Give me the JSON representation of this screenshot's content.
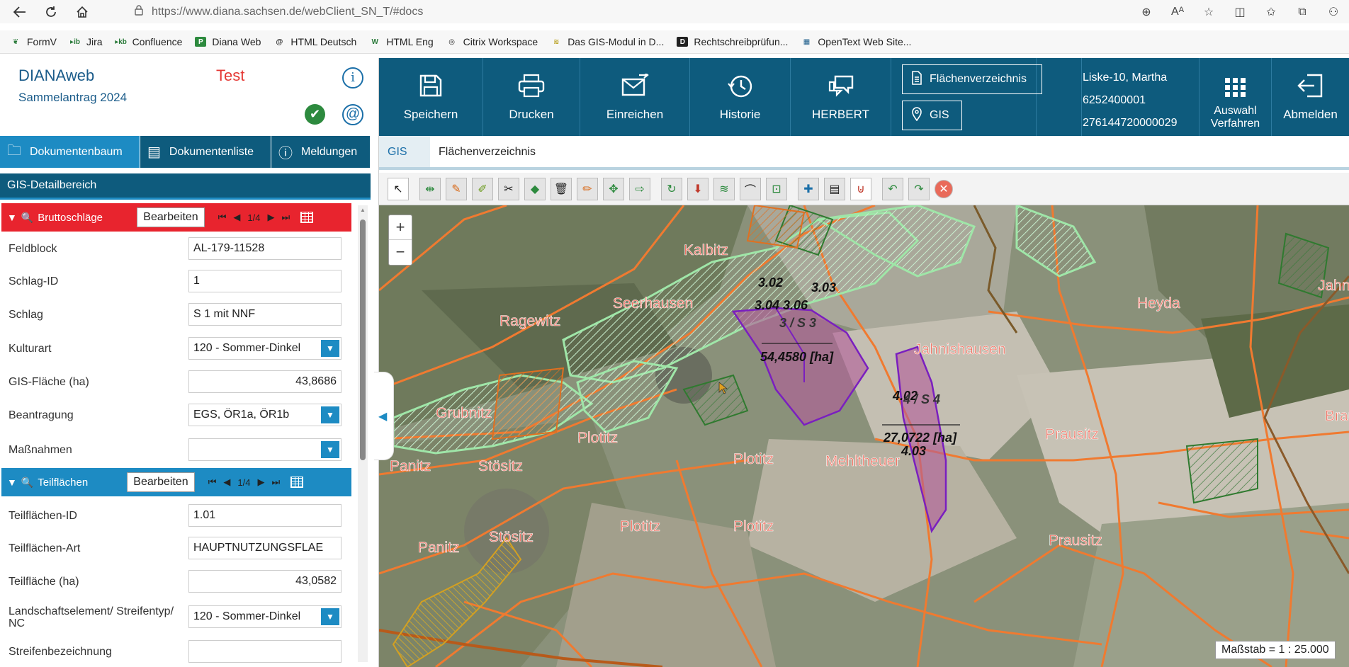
{
  "browser": {
    "url": "https://www.diana.sachsen.de/webClient_SN_T/#docs",
    "bookmarks": [
      {
        "label": "FormV",
        "icon": "wheat-icon"
      },
      {
        "label": "Jira",
        "icon": "jira-icon"
      },
      {
        "label": "Confluence",
        "icon": "confluence-icon"
      },
      {
        "label": "Diana Web",
        "icon": "diana-icon"
      },
      {
        "label": "HTML Deutsch",
        "icon": "html-icon"
      },
      {
        "label": "HTML Eng",
        "icon": "w3-icon"
      },
      {
        "label": "Citrix Workspace",
        "icon": "citrix-icon"
      },
      {
        "label": "Das GIS-Modul in D...",
        "icon": "saxony-icon"
      },
      {
        "label": "Rechtschreibprüfun...",
        "icon": "d-icon"
      },
      {
        "label": "OpenText Web Site...",
        "icon": "opentext-icon"
      }
    ]
  },
  "app": {
    "title": "DIANAweb",
    "subtitle": "Sammelantrag 2024",
    "env": "Test"
  },
  "left_tabs": [
    {
      "label": "Dokumentenbaum",
      "icon": "folder-icon"
    },
    {
      "label": "Dokumentenliste",
      "icon": "list-icon"
    },
    {
      "label": "Meldungen",
      "icon": "alert-icon"
    }
  ],
  "section_title": "GIS-Detailbereich",
  "groups": [
    {
      "title": "Bruttoschläge",
      "button": "Bearbeiten",
      "pager": "1/4"
    },
    {
      "title": "Teilflächen",
      "button": "Bearbeiten",
      "pager": "1/4"
    }
  ],
  "fields1": [
    {
      "label": "Feldblock",
      "value": "AL-179-11528"
    },
    {
      "label": "Schlag-ID",
      "value": "1"
    },
    {
      "label": "Schlag",
      "value": "S 1 mit NNF"
    },
    {
      "label": "Kulturart",
      "value": "120 - Sommer-Dinkel"
    },
    {
      "label": "GIS-Fläche (ha)",
      "value": "43,8686"
    },
    {
      "label": "Beantragung",
      "value": "EGS, ÖR1a, ÖR1b"
    },
    {
      "label": "Maßnahmen",
      "value": ""
    }
  ],
  "fields2": [
    {
      "label": "Teilflächen-ID",
      "value": "1.01"
    },
    {
      "label": "Teilflächen-Art",
      "value": "HAUPTNUTZUNGSFLAE"
    },
    {
      "label": "Teilfläche (ha)",
      "value": "43,0582"
    },
    {
      "label": "Landschaftselement/ Streifentyp/ NC",
      "value": "120 - Sommer-Dinkel"
    },
    {
      "label": "Streifenbezeichnung",
      "value": ""
    }
  ],
  "toolbar": [
    {
      "label": "Speichern",
      "icon": "save-icon"
    },
    {
      "label": "Drucken",
      "icon": "print-icon"
    },
    {
      "label": "Einreichen",
      "icon": "send-icon"
    },
    {
      "label": "Historie",
      "icon": "history-icon"
    },
    {
      "label": "HERBERT",
      "icon": "chat-icon"
    }
  ],
  "toolbar_boxes": [
    {
      "label": "Flächenverzeichnis",
      "icon": "document-icon"
    },
    {
      "label": "GIS",
      "icon": "location-pin-icon"
    }
  ],
  "user": {
    "name": "Liske-10, Martha",
    "id1": "6252400001",
    "id2": "276144720000029"
  },
  "toolbar_right": [
    {
      "label": "Auswahl Verfahren",
      "icon": "grid-icon"
    },
    {
      "label": "Abmelden",
      "icon": "logout-icon"
    }
  ],
  "subtabs": [
    "GIS",
    "Flächenverzeichnis"
  ],
  "map": {
    "labels": [
      {
        "text": "Kalbitz"
      },
      {
        "text": "Seerhausen"
      },
      {
        "text": "Ragewitz"
      },
      {
        "text": "Grubnitz"
      },
      {
        "text": "Plotitz"
      },
      {
        "text": "Panitz"
      },
      {
        "text": "Stösitz"
      },
      {
        "text": "Mehltheuer"
      },
      {
        "text": "Jahnishausen"
      },
      {
        "text": "Prausitz"
      },
      {
        "text": "Heyda"
      },
      {
        "text": "Jahnis"
      },
      {
        "text": "Braus"
      }
    ],
    "parcel_labels": [
      "3.02",
      "3.03",
      "3.04 3.06",
      "3 / S 3",
      "54,4580 [ha]",
      "4.02",
      "4 / S 4",
      "27,0722 [ha]",
      "4.03"
    ],
    "scale": "Maßstab = 1 : 25.000",
    "zoom_in": "+",
    "zoom_out": "−"
  }
}
